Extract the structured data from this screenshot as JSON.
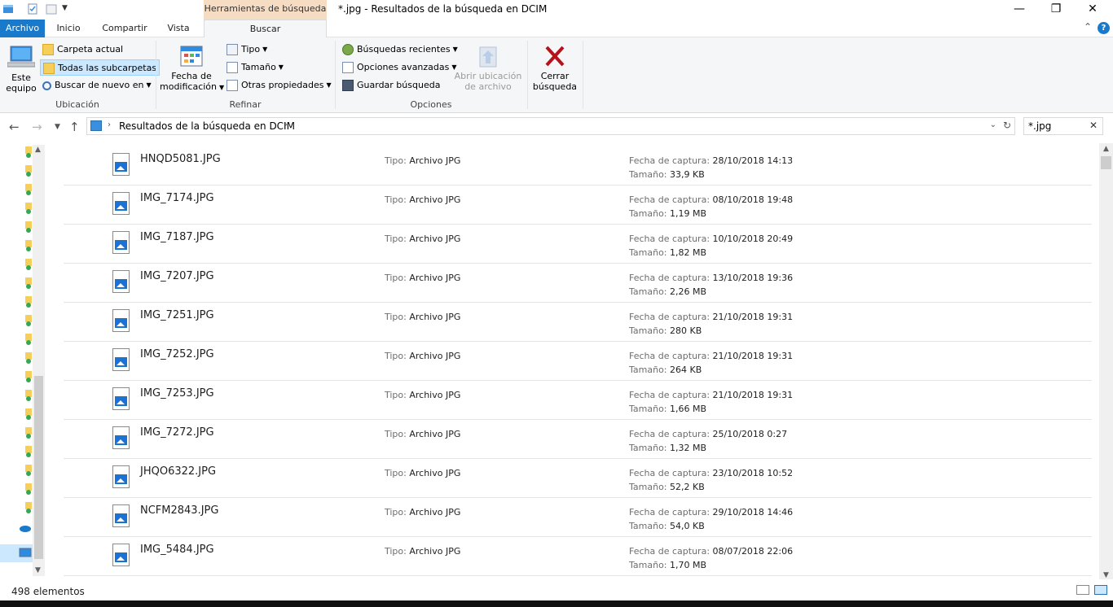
{
  "window": {
    "title": "*.jpg - Resultados de la búsqueda en DCIM",
    "context_tab": "Herramientas de búsqueda"
  },
  "tabs": [
    {
      "label": "Archivo"
    },
    {
      "label": "Inicio"
    },
    {
      "label": "Compartir"
    },
    {
      "label": "Vista"
    },
    {
      "label": "Buscar"
    }
  ],
  "ribbon": {
    "ubicacion": {
      "label": "Ubicación",
      "este_equipo_line1": "Este",
      "este_equipo_line2": "equipo",
      "carpeta_actual": "Carpeta actual",
      "todas_subcarpetas": "Todas las subcarpetas",
      "buscar_de_nuevo": "Buscar de nuevo en"
    },
    "refinar": {
      "label": "Refinar",
      "fecha_line1": "Fecha de",
      "fecha_line2": "modificación",
      "tipo": "Tipo",
      "tamano": "Tamaño",
      "otras": "Otras propiedades"
    },
    "opciones": {
      "label": "Opciones",
      "recientes": "Búsquedas recientes",
      "avanzadas": "Opciones avanzadas",
      "guardar": "Guardar búsqueda",
      "abrir_line1": "Abrir ubicación",
      "abrir_line2": "de archivo"
    },
    "cerrar": {
      "line1": "Cerrar",
      "line2": "búsqueda"
    }
  },
  "address": {
    "path": "Resultados de la búsqueda en DCIM",
    "search_value": "*.jpg"
  },
  "labels": {
    "tipo": "Tipo:",
    "fecha": "Fecha de captura:",
    "tamano": "Tamaño:"
  },
  "files": [
    {
      "name": "HNQD5081.JPG",
      "tipo": "Archivo JPG",
      "fecha": "28/10/2018 14:13",
      "tamano": "33,9 KB"
    },
    {
      "name": "IMG_7174.JPG",
      "tipo": "Archivo JPG",
      "fecha": "08/10/2018 19:48",
      "tamano": "1,19 MB"
    },
    {
      "name": "IMG_7187.JPG",
      "tipo": "Archivo JPG",
      "fecha": "10/10/2018 20:49",
      "tamano": "1,82 MB"
    },
    {
      "name": "IMG_7207.JPG",
      "tipo": "Archivo JPG",
      "fecha": "13/10/2018 19:36",
      "tamano": "2,26 MB"
    },
    {
      "name": "IMG_7251.JPG",
      "tipo": "Archivo JPG",
      "fecha": "21/10/2018 19:31",
      "tamano": "280 KB"
    },
    {
      "name": "IMG_7252.JPG",
      "tipo": "Archivo JPG",
      "fecha": "21/10/2018 19:31",
      "tamano": "264 KB"
    },
    {
      "name": "IMG_7253.JPG",
      "tipo": "Archivo JPG",
      "fecha": "21/10/2018 19:31",
      "tamano": "1,66 MB"
    },
    {
      "name": "IMG_7272.JPG",
      "tipo": "Archivo JPG",
      "fecha": "25/10/2018 0:27",
      "tamano": "1,32 MB"
    },
    {
      "name": "JHQO6322.JPG",
      "tipo": "Archivo JPG",
      "fecha": "23/10/2018 10:52",
      "tamano": "52,2 KB"
    },
    {
      "name": "NCFM2843.JPG",
      "tipo": "Archivo JPG",
      "fecha": "29/10/2018 14:46",
      "tamano": "54,0 KB"
    },
    {
      "name": "IMG_5484.JPG",
      "tipo": "Archivo JPG",
      "fecha": "08/07/2018 22:06",
      "tamano": "1,70 MB"
    }
  ],
  "status": {
    "count": "498 elementos"
  },
  "colors": {
    "accent": "#1979ca",
    "context_tab": "#f7dcc4",
    "close_red": "#b5121b"
  }
}
